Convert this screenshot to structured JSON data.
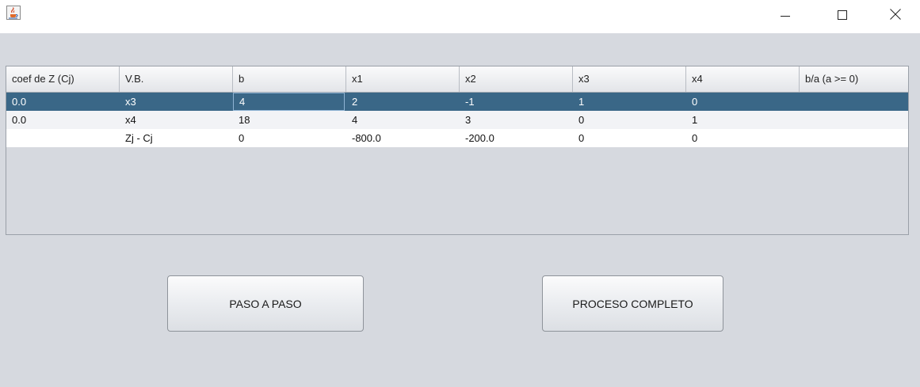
{
  "window": {
    "icon": "java-coffee-icon",
    "controls": [
      "minimize-icon",
      "maximize-icon",
      "close-icon"
    ]
  },
  "table": {
    "columns": [
      "coef de Z (Cj)",
      "V.B.",
      "b",
      "x1",
      "x2",
      "x3",
      "x4",
      "b/a (a >= 0)"
    ],
    "rows": [
      [
        "0.0",
        "x3",
        "4",
        "2",
        "-1",
        "1",
        "0",
        ""
      ],
      [
        "0.0",
        "x4",
        "18",
        "4",
        "3",
        "0",
        "1",
        ""
      ],
      [
        "",
        "Zj - Cj",
        "0",
        "-800.0",
        "-200.0",
        "0",
        "0",
        ""
      ]
    ],
    "selected_row": 0,
    "colors": {
      "selection": "#3a6787",
      "background": "#d6d9df"
    }
  },
  "buttons": {
    "paso_a_paso": "PASO A PASO",
    "proceso_completo": "PROCESO COMPLETO"
  }
}
